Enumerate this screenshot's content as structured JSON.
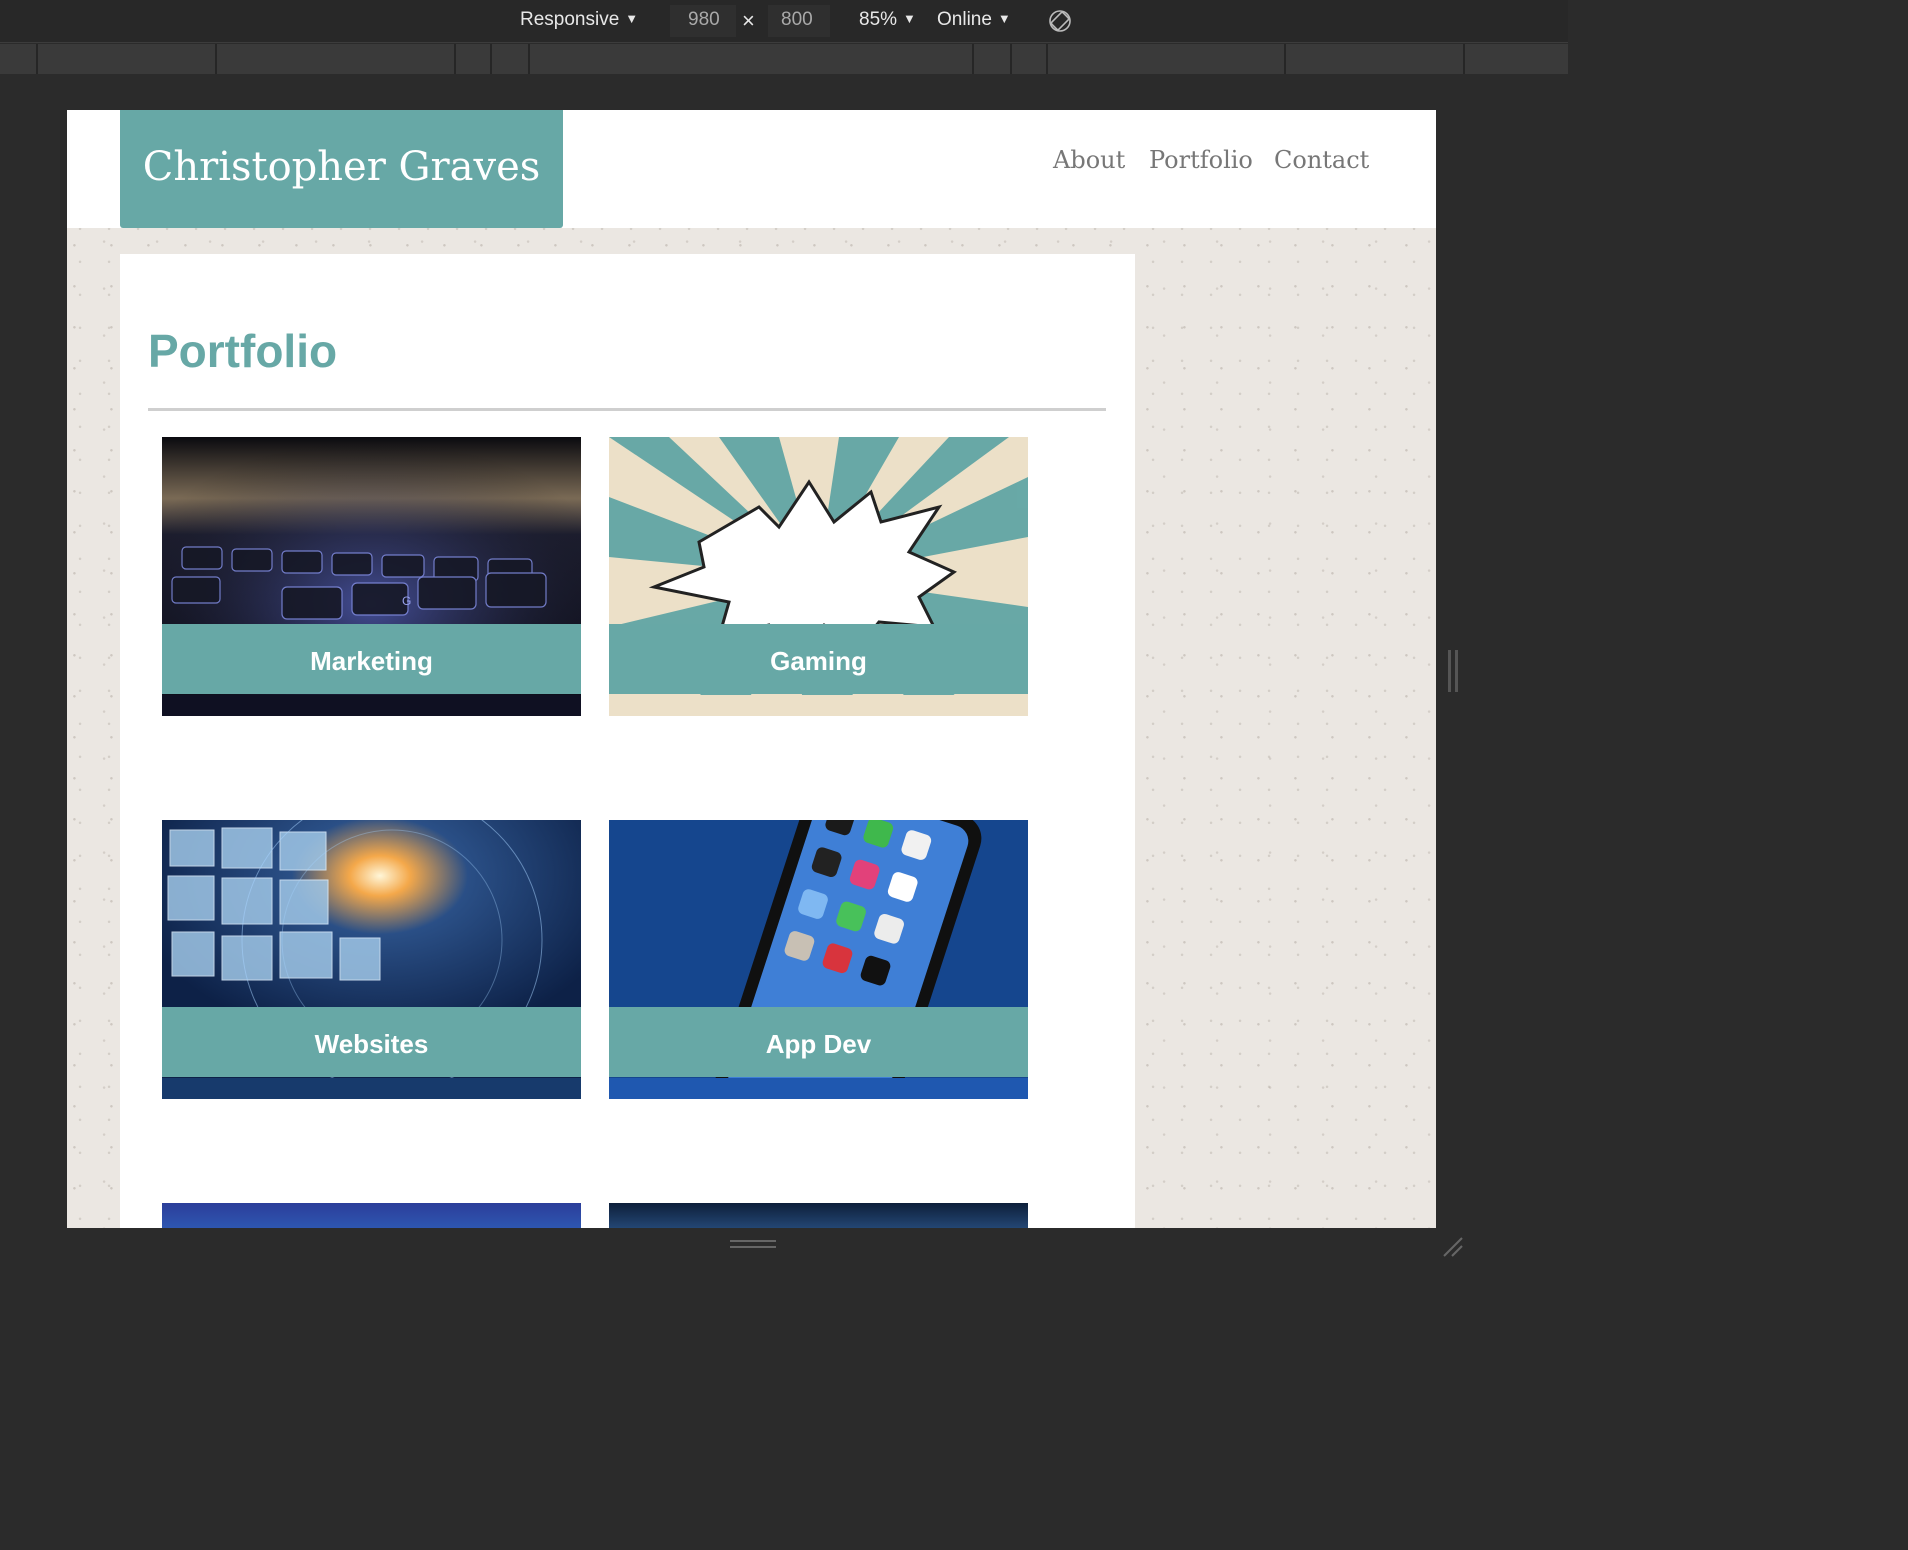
{
  "toolbar": {
    "device_mode": "Responsive",
    "width": "980",
    "times": "×",
    "height": "800",
    "zoom": "85%",
    "throttle": "Online",
    "icons": {
      "rotate": "rotate-icon",
      "caret": "caret-down-icon"
    }
  },
  "site": {
    "brand": "Christopher Graves",
    "nav": [
      "About",
      "Portfolio",
      "Contact"
    ],
    "page_title": "Portfolio",
    "tiles": [
      {
        "label": "Marketing"
      },
      {
        "label": "Gaming"
      },
      {
        "label": "Websites"
      },
      {
        "label": "App Dev"
      }
    ],
    "colors": {
      "accent": "#67a8a6",
      "background": "#ebe7e2",
      "nav_text": "#777777"
    }
  }
}
